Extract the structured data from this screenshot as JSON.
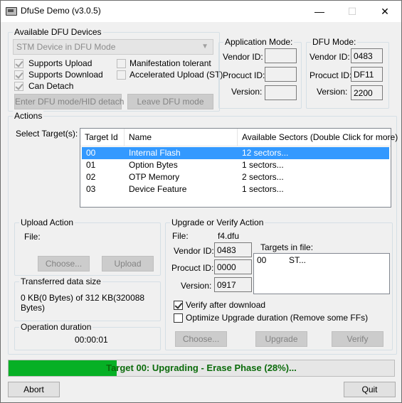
{
  "window": {
    "title": "DfuSe Demo (v3.0.5)",
    "minimize": "—",
    "maximize": "☐",
    "close": "✕"
  },
  "devices": {
    "group_label": "Available DFU Devices",
    "combo_value": "STM Device in DFU Mode",
    "supports_upload": "Supports Upload",
    "supports_download": "Supports Download",
    "can_detach": "Can Detach",
    "manifestation_tolerant": "Manifestation tolerant",
    "accelerated_upload": "Accelerated Upload (ST)",
    "enter_dfu": "Enter DFU mode/HID detach",
    "leave_dfu": "Leave DFU mode"
  },
  "app_mode": {
    "group_label": "Application Mode:",
    "vendor_label": "Vendor ID:",
    "product_label": "Procuct ID:",
    "version_label": "Version:",
    "vendor_value": "",
    "product_value": "",
    "version_value": ""
  },
  "dfu_mode": {
    "group_label": "DFU Mode:",
    "vendor_label": "Vendor ID:",
    "product_label": "Procuct ID:",
    "version_label": "Version:",
    "vendor_value": "0483",
    "product_value": "DF11",
    "version_value": "2200"
  },
  "actions": {
    "group_label": "Actions",
    "select_target_label": "Select Target(s):",
    "columns": [
      "Target Id",
      "Name",
      "Available Sectors (Double Click for more)"
    ],
    "targets": [
      {
        "id": "00",
        "name": "Internal Flash",
        "sectors": "12 sectors..."
      },
      {
        "id": "01",
        "name": "Option Bytes",
        "sectors": "1 sectors..."
      },
      {
        "id": "02",
        "name": "OTP Memory",
        "sectors": "2 sectors..."
      },
      {
        "id": "03",
        "name": "Device Feature",
        "sectors": "1 sectors..."
      }
    ]
  },
  "upload": {
    "group_label": "Upload Action",
    "file_label": "File:",
    "choose": "Choose...",
    "upload": "Upload"
  },
  "transferred": {
    "group_label": "Transferred data size",
    "value": "0 KB(0 Bytes) of 312 KB(320088 Bytes)"
  },
  "duration": {
    "group_label": "Operation duration",
    "value": "00:00:01"
  },
  "upgrade": {
    "group_label": "Upgrade or Verify Action",
    "file_label": "File:",
    "file_value": "f4.dfu",
    "vendor_label": "Vendor ID:",
    "product_label": "Procuct ID:",
    "version_label": "Version:",
    "vendor_value": "0483",
    "product_value": "0000",
    "version_value": "0917",
    "targets_label": "Targets in file:",
    "targets_row_id": "00",
    "targets_row_name": "ST...",
    "verify_after": "Verify after download",
    "optimize": "Optimize Upgrade duration (Remove some FFs)",
    "choose": "Choose...",
    "upgrade": "Upgrade",
    "verify": "Verify"
  },
  "progress": {
    "text": "Target 00: Upgrading - Erase Phase (28%)...",
    "fraction": 0.28,
    "color": "#06b025"
  },
  "footer": {
    "abort": "Abort",
    "quit": "Quit"
  }
}
